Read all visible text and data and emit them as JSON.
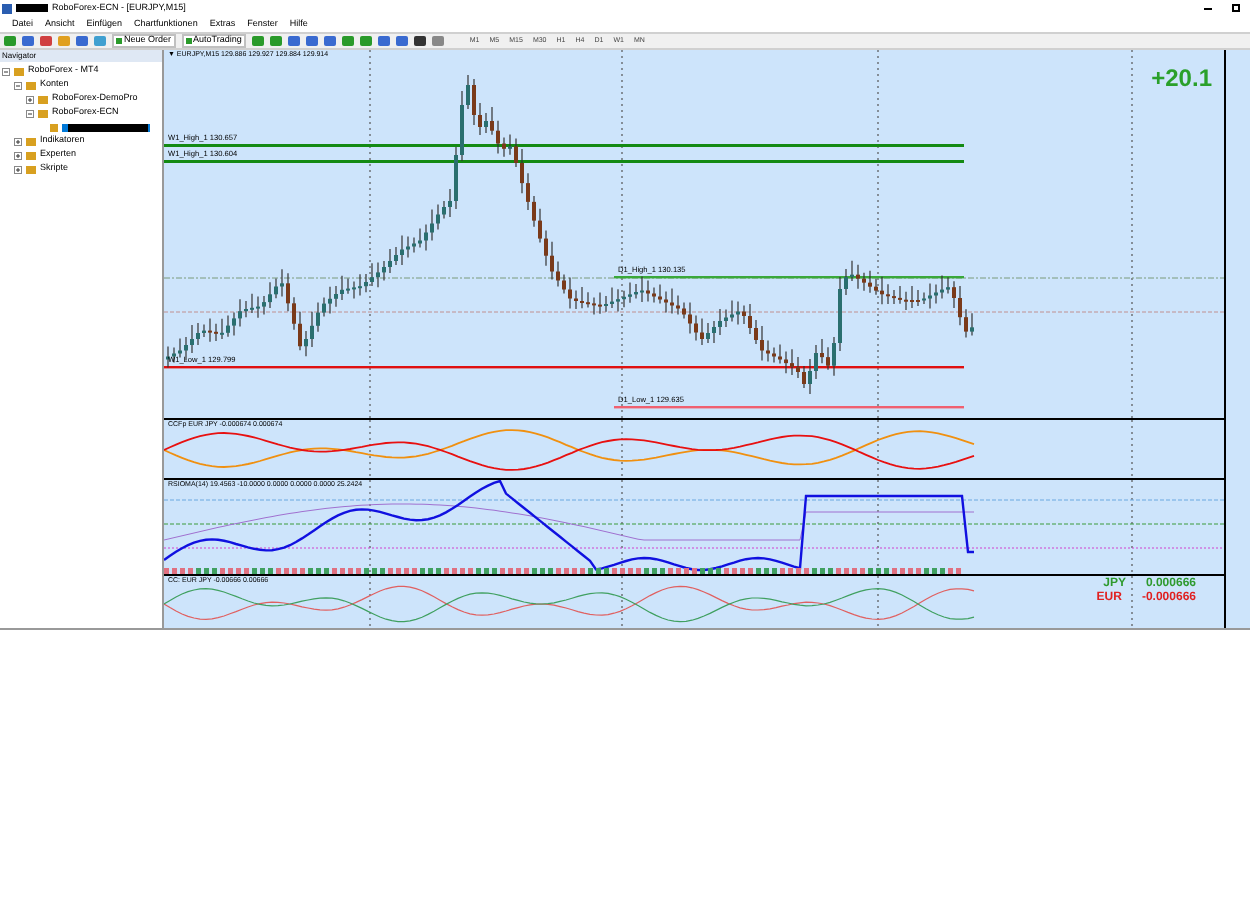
{
  "window": {
    "title": "RoboForex-ECN - [EURJPY,M15]"
  },
  "menu": [
    "Datei",
    "Ansicht",
    "Einfügen",
    "Chartfunktionen",
    "Extras",
    "Fenster",
    "Hilfe"
  ],
  "toolbar": {
    "buttons": [
      "Neue Order",
      "AutoTrading"
    ],
    "timeframes": [
      "M1",
      "M5",
      "M15",
      "M30",
      "H1",
      "H4",
      "D1",
      "W1",
      "MN"
    ]
  },
  "navigator": {
    "title": "Navigator",
    "items": [
      {
        "kind": "node",
        "label": "RoboForex - MT4",
        "expanded": true,
        "selected": false,
        "children": [
          {
            "kind": "node",
            "label": "Konten",
            "expanded": true,
            "selected": false,
            "children": [
              {
                "kind": "node",
                "label": "RoboForex-DemoPro",
                "expanded": false,
                "selected": false
              },
              {
                "kind": "node",
                "label": "RoboForex-ECN",
                "expanded": true,
                "selected": false,
                "children": [
                  {
                    "kind": "account",
                    "selected": true
                  }
                ]
              }
            ]
          },
          {
            "kind": "node",
            "label": "Indikatoren",
            "expanded": false,
            "selected": false
          },
          {
            "kind": "node",
            "label": "Experten",
            "expanded": false,
            "selected": false
          },
          {
            "kind": "node",
            "label": "Skripte",
            "expanded": false,
            "selected": false
          }
        ]
      }
    ]
  },
  "chart": {
    "title": "▼ EURJPY,M15 129.886 129.927 129.884 129.914",
    "profit": "+20.1",
    "levels": [
      {
        "label": "W1_High_1   130.657",
        "color": "#138a13"
      },
      {
        "label": "W1_High_1   130.604",
        "color": "#138a13"
      },
      {
        "label": "D1_High_1   130.135",
        "color": "#3aa83a"
      },
      {
        "label": "W1_Low_1   129.799",
        "color": "#e01010"
      },
      {
        "label": "D1_Low_1   129.635",
        "color": "#f06070"
      }
    ],
    "indicators": [
      {
        "kind": "ccfp",
        "title": "CCFp  EUR JPY  -0.000674 0.000674"
      },
      {
        "kind": "rsioma",
        "title": "RSIOMA(14) 19.4563 -10.0000 0.0000 0.0000 0.0000 25.2424"
      },
      {
        "kind": "cc",
        "title": "CC:  EUR JPY  -0.00666 0.00666",
        "legend": [
          {
            "label": "JPY",
            "value": "0.000666",
            "color": "#2e9a2e"
          },
          {
            "label": "EUR",
            "value": "-0.000666",
            "color": "#e02020"
          }
        ]
      }
    ]
  }
}
